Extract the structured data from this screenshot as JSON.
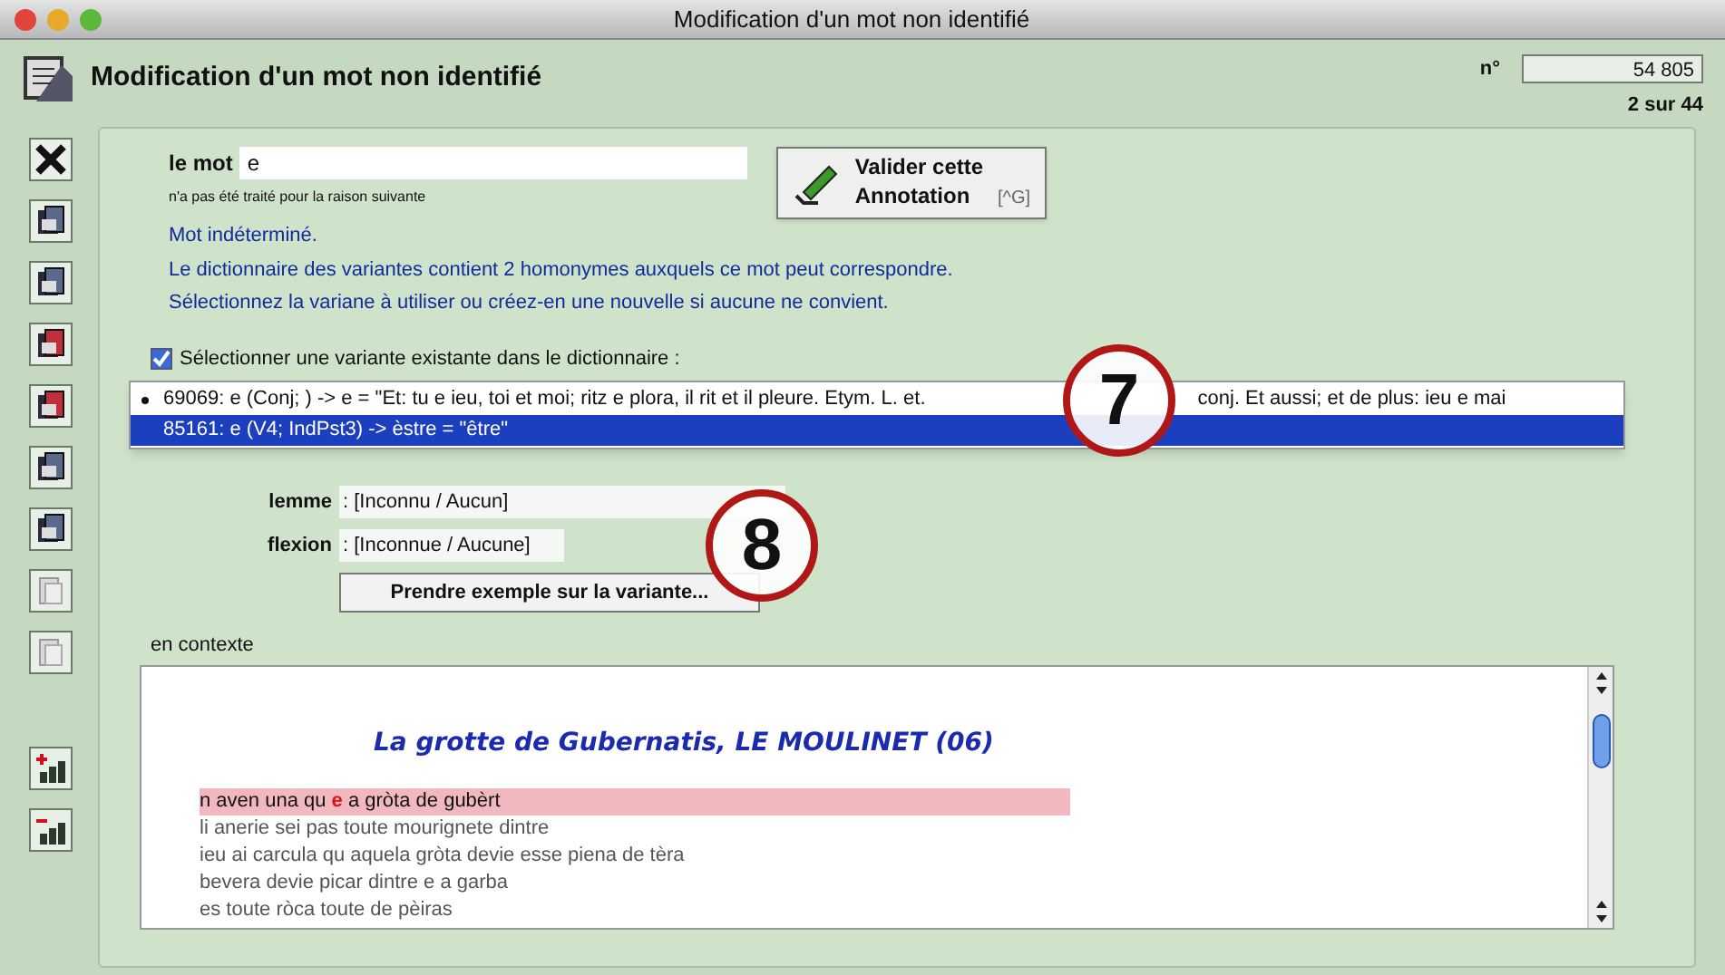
{
  "window": {
    "title": "Modification d'un mot non identifié"
  },
  "header": {
    "title": "Modification d'un mot non identifié",
    "number_label": "n°",
    "number": "54 805",
    "position": "2 sur 44"
  },
  "word": {
    "label": "le mot",
    "value": "e",
    "reason_label": "n'a pas été traité pour la raison suivante"
  },
  "validate_button": {
    "line1": "Valider cette",
    "line2": "Annotation",
    "shortcut": "[^G]"
  },
  "messages": [
    "Mot indéterminé.",
    "Le dictionnaire des variantes contient 2 homonymes auxquels ce mot peut correspondre.",
    "Sélectionnez la variane à utiliser ou créez-en une nouvelle si aucune ne convient."
  ],
  "select_existing": {
    "label": "Sélectionner une variante existante dans le dictionnaire :",
    "checked": true
  },
  "variants": [
    {
      "text": "69069: e (Conj; ) -> e = \"Et: tu e ieu, toi et moi; ritz e plora, il rit et il pleure. Etym. L. et.",
      "text_after": "conj. Et aussi; et de plus: ieu e mai",
      "selected": false
    },
    {
      "text": "85161: e (V4; IndPst3) -> èstre = \"être\"",
      "selected": true
    }
  ],
  "fields": [
    {
      "label": "lemme",
      "value": ": [Inconnu / Aucun]"
    },
    {
      "label": "flexion",
      "value": ": [Inconnue / Aucune]"
    }
  ],
  "example_button": "Prendre exemple sur la variante...",
  "context": {
    "label": "en contexte",
    "title": "La grotte de Gubernatis, LE MOULINET (06)",
    "lines": [
      {
        "selected": true,
        "parts": [
          {
            "kind": "plain",
            "text": "n aven una qu "
          },
          {
            "kind": "match",
            "text": "e"
          },
          {
            "kind": "plain",
            "text": " a gròta de gubèrt"
          }
        ]
      },
      {
        "selected": false,
        "parts": [
          {
            "kind": "plain",
            "text": "li anerie sei pas toute mourignete dintre"
          }
        ]
      },
      {
        "selected": false,
        "parts": [
          {
            "kind": "plain",
            "text": "ieu ai carcula qu aquela gròta devie esse piena de tèra"
          }
        ]
      },
      {
        "selected": false,
        "parts": [
          {
            "kind": "plain",
            "text": "bevera devie picar dintre e a garba"
          }
        ]
      },
      {
        "selected": false,
        "parts": [
          {
            "kind": "plain",
            "text": "es toute ròca toute de pèiras"
          }
        ]
      }
    ]
  },
  "callouts": [
    "7",
    "8"
  ]
}
